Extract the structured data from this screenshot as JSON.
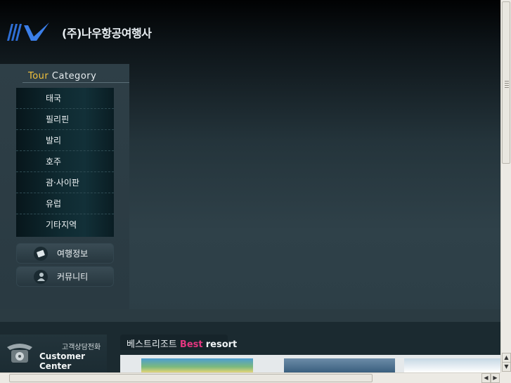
{
  "header": {
    "company_name": "(주)나우항공여행사"
  },
  "sidebar": {
    "title_accent": "Tour",
    "title_rest": "Category",
    "menu_items": [
      "태국",
      "필리핀",
      "발리",
      "호주",
      "괌·사이판",
      "유럽",
      "기타지역"
    ],
    "extra_buttons": [
      {
        "label": "여행정보",
        "icon": "travel-info-icon"
      },
      {
        "label": "커뮤니티",
        "icon": "community-icon"
      }
    ]
  },
  "customer_center": {
    "subtitle": "고객상담전화",
    "title": "Customer Center",
    "icon": "telephone-icon"
  },
  "best_resort": {
    "korean": "베스트리조트",
    "best": "Best",
    "resort": "resort"
  },
  "colors": {
    "accent_yellow": "#f3c23b",
    "accent_pink": "#e2367f",
    "logo_blue": "#2f6fd6"
  }
}
